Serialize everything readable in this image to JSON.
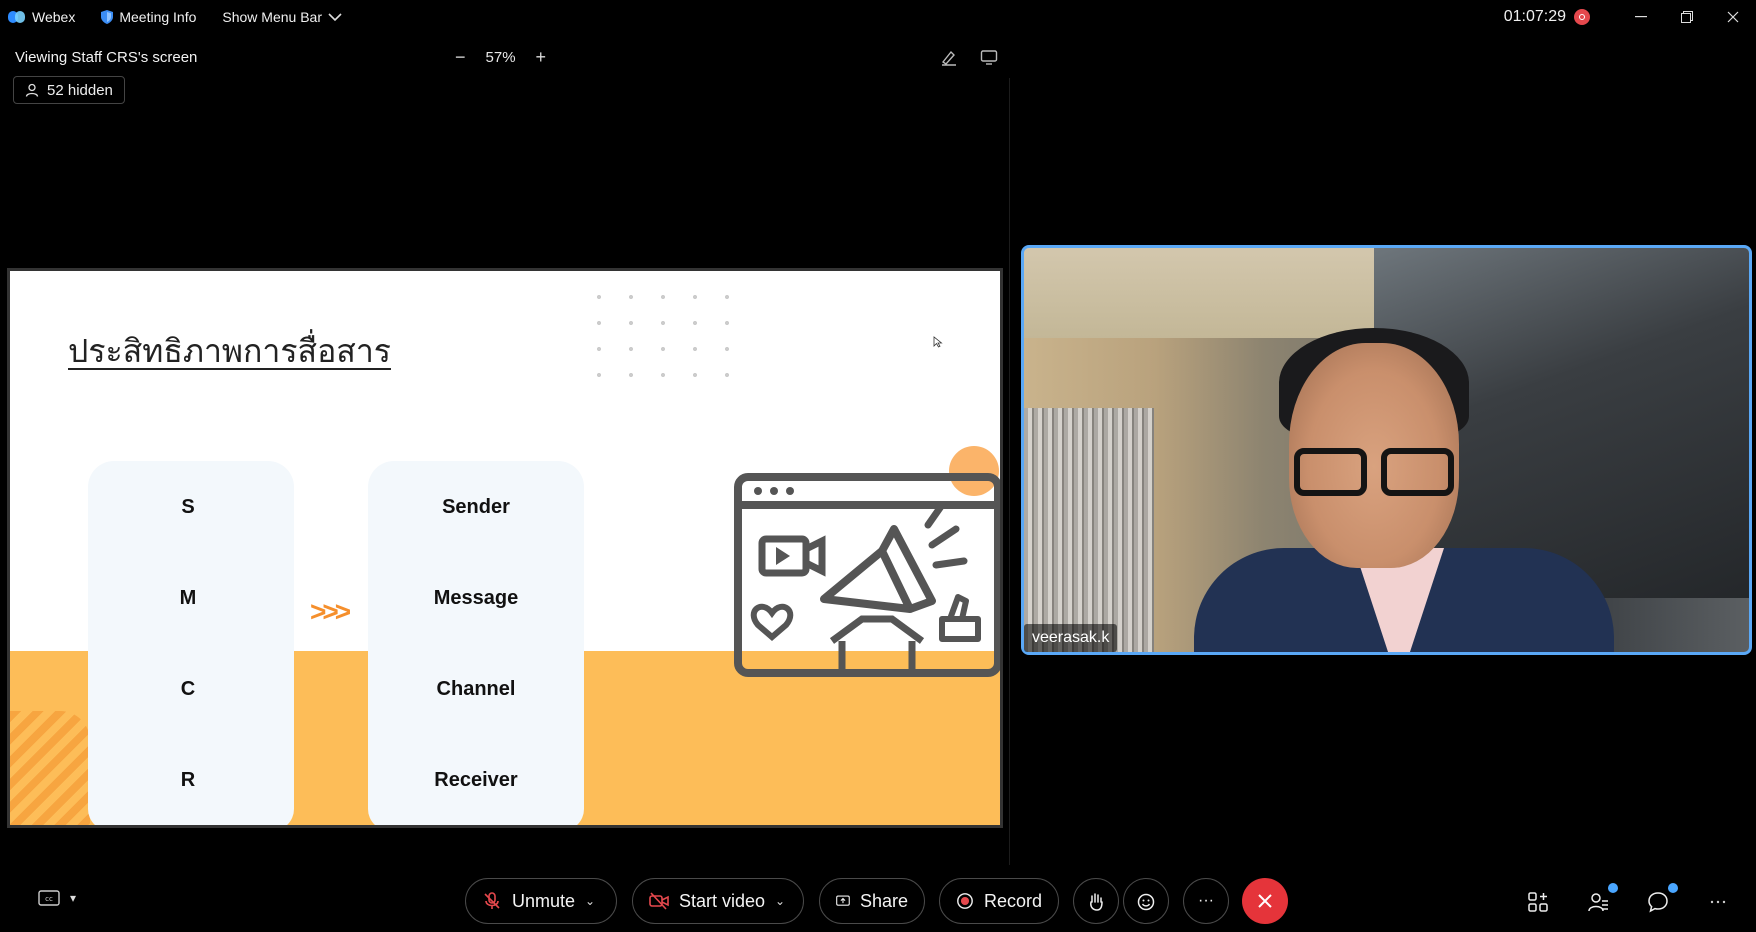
{
  "titlebar": {
    "app_name": "Webex",
    "meeting_info": "Meeting Info",
    "show_menu_bar": "Show Menu Bar",
    "clock": "01:07:29"
  },
  "share": {
    "viewing_label": "Viewing Staff CRS's screen",
    "zoom_minus": "−",
    "zoom_level": "57%",
    "zoom_plus": "+",
    "hidden_count": "52 hidden"
  },
  "slide": {
    "title": "ประสิทธิภาพการสื่อสาร",
    "left_column": [
      "S",
      "M",
      "C",
      "R"
    ],
    "right_column": [
      "Sender",
      "Message",
      "Channel",
      "Receiver"
    ],
    "arrow": ">>>"
  },
  "video": {
    "participant_name": "veerasak.k"
  },
  "toolbar": {
    "unmute": "Unmute",
    "start_video": "Start video",
    "share": "Share",
    "record": "Record",
    "more": "···"
  },
  "colors": {
    "accent_blue": "#5aa8f6",
    "end_red": "#e5343a",
    "slide_orange": "#fdbd58"
  }
}
